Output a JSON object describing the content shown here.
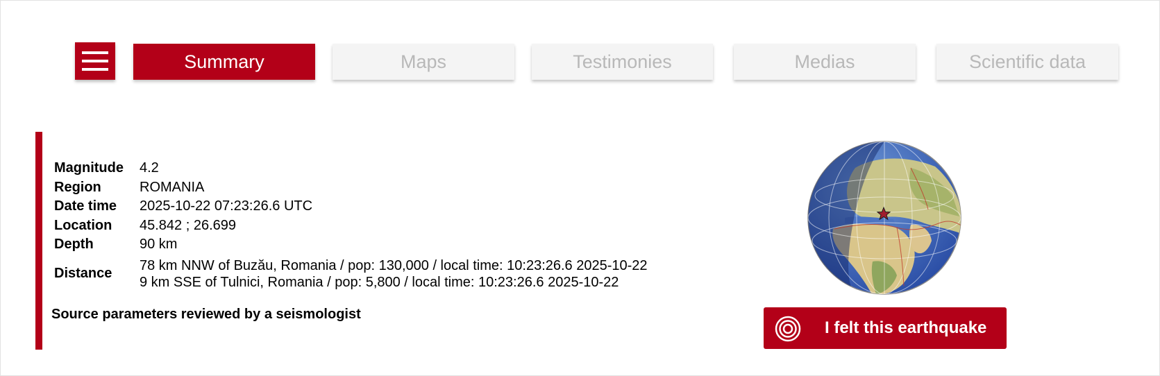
{
  "nav": {
    "menu_icon": "hamburger-menu-icon",
    "tabs": [
      {
        "label": "Summary",
        "active": true
      },
      {
        "label": "Maps",
        "active": false
      },
      {
        "label": "Testimonies",
        "active": false
      },
      {
        "label": "Medias",
        "active": false
      },
      {
        "label": "Scientific data",
        "active": false
      }
    ]
  },
  "summary": {
    "rows": [
      {
        "label": "Magnitude",
        "value": "4.2"
      },
      {
        "label": "Region",
        "value": "ROMANIA"
      },
      {
        "label": "Date time",
        "value": "2025-10-22 07:23:26.6 UTC"
      },
      {
        "label": "Location",
        "value": "45.842 ; 26.699"
      },
      {
        "label": "Depth",
        "value": "90 km"
      }
    ],
    "distance_label": "Distance",
    "distances": [
      "78 km NNW of Buzău, Romania / pop: 130,000 / local time: 10:23:26.6 2025-10-22",
      "9 km SSE of Tulnici, Romania / pop: 5,800 / local time: 10:23:26.6 2025-10-22"
    ],
    "reviewed_note": "Source parameters reviewed by a seismologist"
  },
  "globe": {
    "icon": "globe-epicenter-map",
    "marker_icon": "star-icon"
  },
  "felt_button": {
    "label": "I felt this earthquake",
    "icon": "seismic-waves-icon"
  },
  "colors": {
    "accent": "#b30018",
    "tab_inactive_bg": "#f4f4f4",
    "tab_inactive_text": "#b8b8b8"
  }
}
